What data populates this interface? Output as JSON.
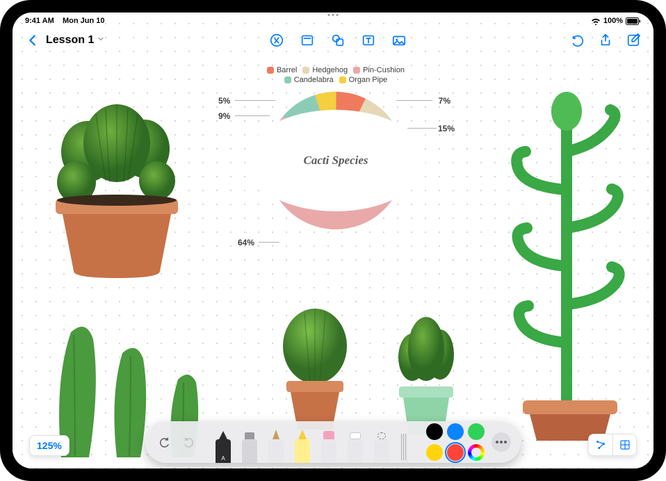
{
  "status": {
    "time": "9:41 AM",
    "date": "Mon Jun 10",
    "battery": "100%"
  },
  "toolbar": {
    "back": "Back",
    "title": "Lesson 1"
  },
  "zoom": "125%",
  "chart_data": {
    "type": "pie",
    "title": "Cacti Species",
    "series": [
      {
        "name": "Barrel",
        "value": 7,
        "color": "#f07a5e",
        "label": "7%"
      },
      {
        "name": "Hedgehog",
        "value": 15,
        "color": "#e6d7b6",
        "label": "15%"
      },
      {
        "name": "Pin-Cushion",
        "value": 64,
        "color": "#e9a9a8",
        "label": "64%"
      },
      {
        "name": "Candelabra",
        "value": 9,
        "color": "#8cccb7",
        "label": "9%"
      },
      {
        "name": "Organ Pipe",
        "value": 5,
        "color": "#f4cf3f",
        "label": "5%"
      }
    ],
    "legend_order": [
      "Barrel",
      "Hedgehog",
      "Pin-Cushion",
      "Candelabra",
      "Organ Pipe"
    ]
  },
  "tools": {
    "undo": "Undo",
    "redo": "Redo",
    "colors": [
      "#000000",
      "#0b84ff",
      "#30d158",
      "#ffd50a",
      "#ff453a"
    ],
    "selected_color_index": 2
  }
}
